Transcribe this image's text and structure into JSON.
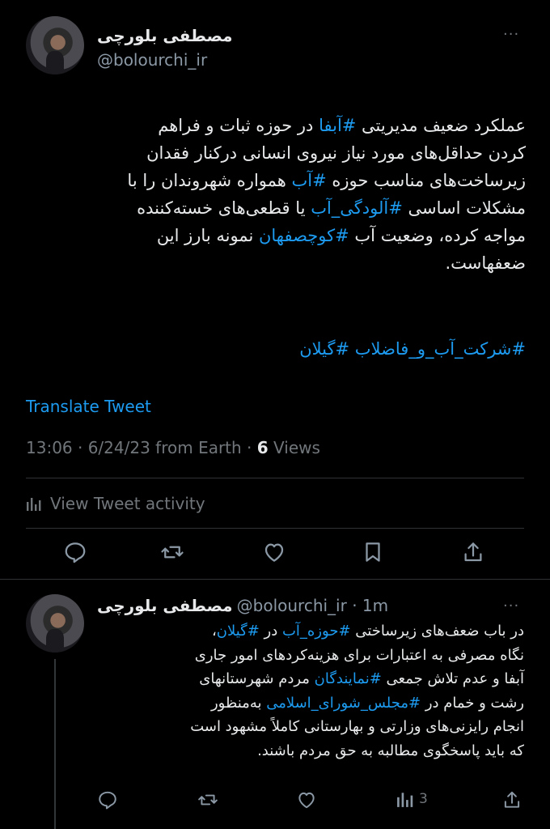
{
  "main_tweet": {
    "author_name": "مصطفی بلورچی",
    "author_handle": "@bolourchi_ir",
    "more": "···",
    "lines": [
      [
        "عملکرد ضعیف مدیریتی ",
        {
          "tag": "#آبفا"
        },
        " در حوزه ثبات و فراهم"
      ],
      [
        "کردن حداقل‌های مورد نیاز نیروی انسانی درکنار فقدان"
      ],
      [
        "زیرساخت‌های مناسب حوزه ",
        {
          "tag": "#آب"
        },
        " همواره شهروندان را با"
      ],
      [
        "مشکلات اساسی ",
        {
          "tag": "#آلودگی_آب"
        },
        " یا قطعی‌های خسته‌کننده"
      ],
      [
        "مواجه کرده، وضعیت آب ",
        {
          "tag": "#کوچصفهان"
        },
        " نمونه بارز این"
      ],
      [
        "ضعفهاست."
      ]
    ],
    "hashtag_line": "#شرکت_آب_و_فاضلاب #گیلان",
    "translate": "Translate Tweet",
    "timestamp": "13:06 · 6/24/23 from Earth · ",
    "views_count": "6",
    "views_label": " Views",
    "activity_label": "View Tweet activity"
  },
  "reply_tweet": {
    "author_name": "مصطفی بلورچی",
    "author_handle": "@bolourchi_ir",
    "time": " · 1m",
    "more": "···",
    "lines": [
      [
        "در باب ضعف‌های زیرساختی ",
        {
          "tag": "#حوزه_آب"
        },
        " در ",
        {
          "tag": "#گیلان"
        },
        "،"
      ],
      [
        "نگاه مصرفی به اعتبارات برای هزینه‌کردهای امور جاری"
      ],
      [
        "آبفا و عدم تلاش جمعی ",
        {
          "tag": "#نمایندگان"
        },
        " مردم شهرستانهای"
      ],
      [
        "رشت و خمام در ",
        {
          "tag": "#مجلس_شورای_اسلامی"
        },
        " به‌منظور"
      ],
      [
        "انجام رایزنی‌های وزارتی و بهارستانی کاملاً مشهود است"
      ],
      [
        "که باید پاسخگوی مطالبه به حق مردم باشند."
      ]
    ],
    "views_count": "3"
  },
  "colors": {
    "accent": "#1d9bf0",
    "muted": "#71767b",
    "text": "#e7e9ea",
    "bg": "#000000"
  }
}
